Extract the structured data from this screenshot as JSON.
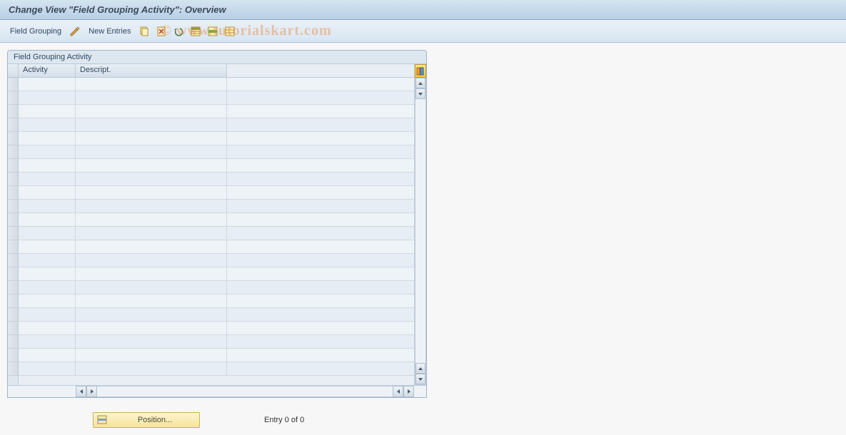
{
  "title": "Change View \"Field Grouping Activity\": Overview",
  "toolbar": {
    "field_grouping_label": "Field Grouping",
    "new_entries_label": "New Entries",
    "icons": {
      "display_change": "display-change-icon",
      "copy": "copy-icon",
      "delete": "delete-icon",
      "undo": "undo-icon",
      "select_all": "select-all-icon",
      "select_block": "select-block-icon",
      "deselect_all": "deselect-all-icon"
    }
  },
  "panel": {
    "title": "Field Grouping Activity",
    "columns": {
      "activity": "Activity",
      "descript": "Descript."
    },
    "row_count": 22,
    "rows": []
  },
  "footer": {
    "position_label": "Position...",
    "entry_label": "Entry 0 of 0"
  },
  "watermark": "© www.tutorialskart.com"
}
